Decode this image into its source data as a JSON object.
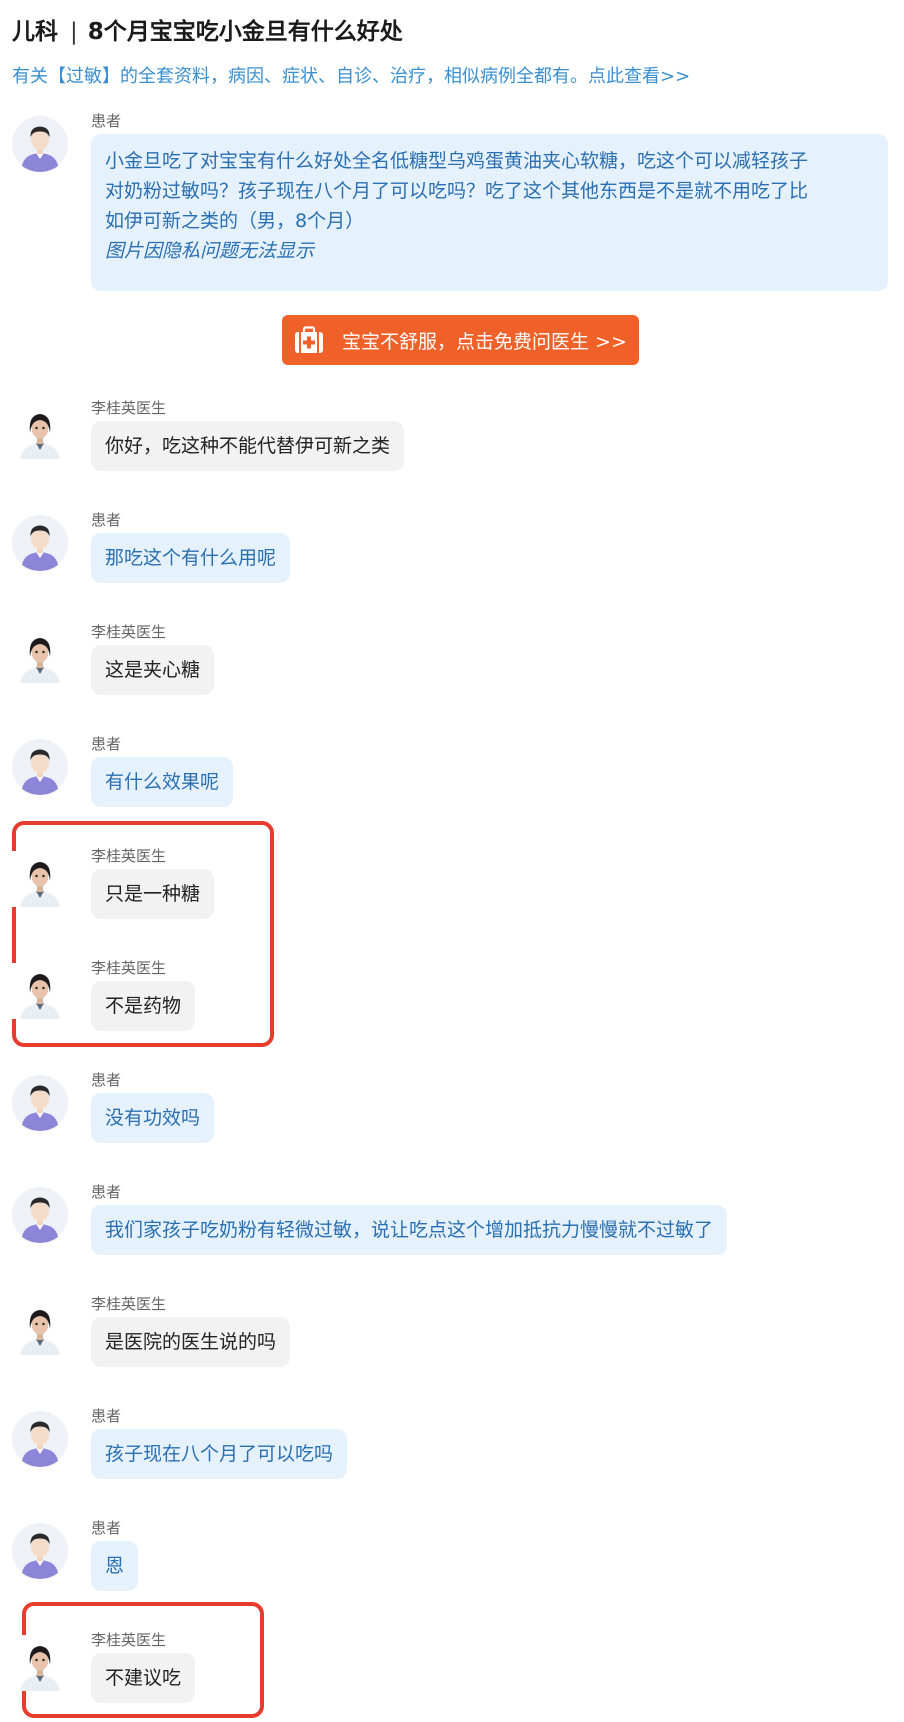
{
  "header": {
    "department": "儿科",
    "separator": "|",
    "title": "8个月宝宝吃小金旦有什么好处"
  },
  "related_link": "有关【过敏】的全套资料，病因、症状、自诊、治疗，相似病例全都有。点此查看>>",
  "cta": {
    "label": "宝宝不舒服，点击免费问医生  >>",
    "icon": "medical-kit-icon",
    "color": "#f0612a"
  },
  "colors": {
    "patient_bubble": "#e5f1fc",
    "patient_text": "#2b6fb3",
    "doctor_bubble": "#f2f2f2",
    "highlight": "#e53c2e",
    "link": "#3a8fd0"
  },
  "messages": [
    {
      "sender": "患者",
      "role": "patient",
      "lines": [
        "小金旦吃了对宝宝有什么好处全名低糖型乌鸡蛋黄油夹心软糖，吃这个可以减轻孩子",
        "对奶粉过敏吗？孩子现在八个月了可以吃吗？吃了这个其他东西是不是就不用吃了比",
        "如伊可新之类的（男，8个月）"
      ],
      "note": "图片因隐私问题无法显示"
    },
    {
      "sender": "李桂英医生",
      "role": "doctor",
      "text": "你好，吃这种不能代替伊可新之类"
    },
    {
      "sender": "患者",
      "role": "patient",
      "text": "那吃这个有什么用呢"
    },
    {
      "sender": "李桂英医生",
      "role": "doctor",
      "text": "这是夹心糖"
    },
    {
      "sender": "患者",
      "role": "patient",
      "text": "有什么效果呢"
    },
    {
      "sender": "李桂英医生",
      "role": "doctor",
      "text": "只是一种糖"
    },
    {
      "sender": "李桂英医生",
      "role": "doctor",
      "text": "不是药物"
    },
    {
      "sender": "患者",
      "role": "patient",
      "text": "没有功效吗"
    },
    {
      "sender": "患者",
      "role": "patient",
      "text": "我们家孩子吃奶粉有轻微过敏，说让吃点这个增加抵抗力慢慢就不过敏了"
    },
    {
      "sender": "李桂英医生",
      "role": "doctor",
      "text": "是医院的医生说的吗"
    },
    {
      "sender": "患者",
      "role": "patient",
      "text": "孩子现在八个月了可以吃吗"
    },
    {
      "sender": "患者",
      "role": "patient",
      "text": "恩"
    },
    {
      "sender": "李桂英医生",
      "role": "doctor",
      "text": "不建议吃"
    }
  ]
}
